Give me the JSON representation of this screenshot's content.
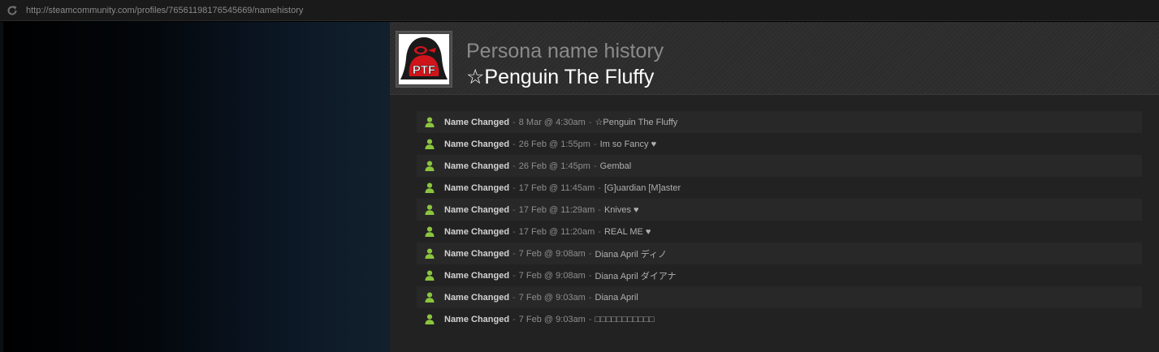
{
  "browser": {
    "url": "http://steamcommunity.com/profiles/76561198176545669/namehistory"
  },
  "header": {
    "title": "Persona name history",
    "persona_name": "☆Penguin The Fluffy",
    "avatar_text": "PTF"
  },
  "history": {
    "separator": "-",
    "entries": [
      {
        "label": "Name Changed",
        "date": "8 Mar @ 4:30am",
        "name": "☆Penguin The Fluffy"
      },
      {
        "label": "Name Changed",
        "date": "26 Feb @ 1:55pm",
        "name": "Im so Fancy ♥"
      },
      {
        "label": "Name Changed",
        "date": "26 Feb @ 1:45pm",
        "name": "Gembal"
      },
      {
        "label": "Name Changed",
        "date": "17 Feb @ 11:45am",
        "name": "[G]uardian [M]aster"
      },
      {
        "label": "Name Changed",
        "date": "17 Feb @ 11:29am",
        "name": "Knives ♥"
      },
      {
        "label": "Name Changed",
        "date": "17 Feb @ 11:20am",
        "name": "REAL ME ♥"
      },
      {
        "label": "Name Changed",
        "date": "7 Feb @ 9:08am",
        "name": "Diana April ディノ"
      },
      {
        "label": "Name Changed",
        "date": "7 Feb @ 9:08am",
        "name": "Diana April ダイアナ"
      },
      {
        "label": "Name Changed",
        "date": "7 Feb @ 9:03am",
        "name": "Diana April"
      },
      {
        "label": "Name Changed",
        "date": "7 Feb @ 9:03am",
        "name": "□□□□□□□□□□□"
      }
    ]
  },
  "colors": {
    "user_icon": "#8bc53f",
    "avatar_red": "#d0141b",
    "avatar_dark": "#1a1a1a"
  },
  "icons": {
    "reload": "reload-icon",
    "entry": "user-icon"
  }
}
